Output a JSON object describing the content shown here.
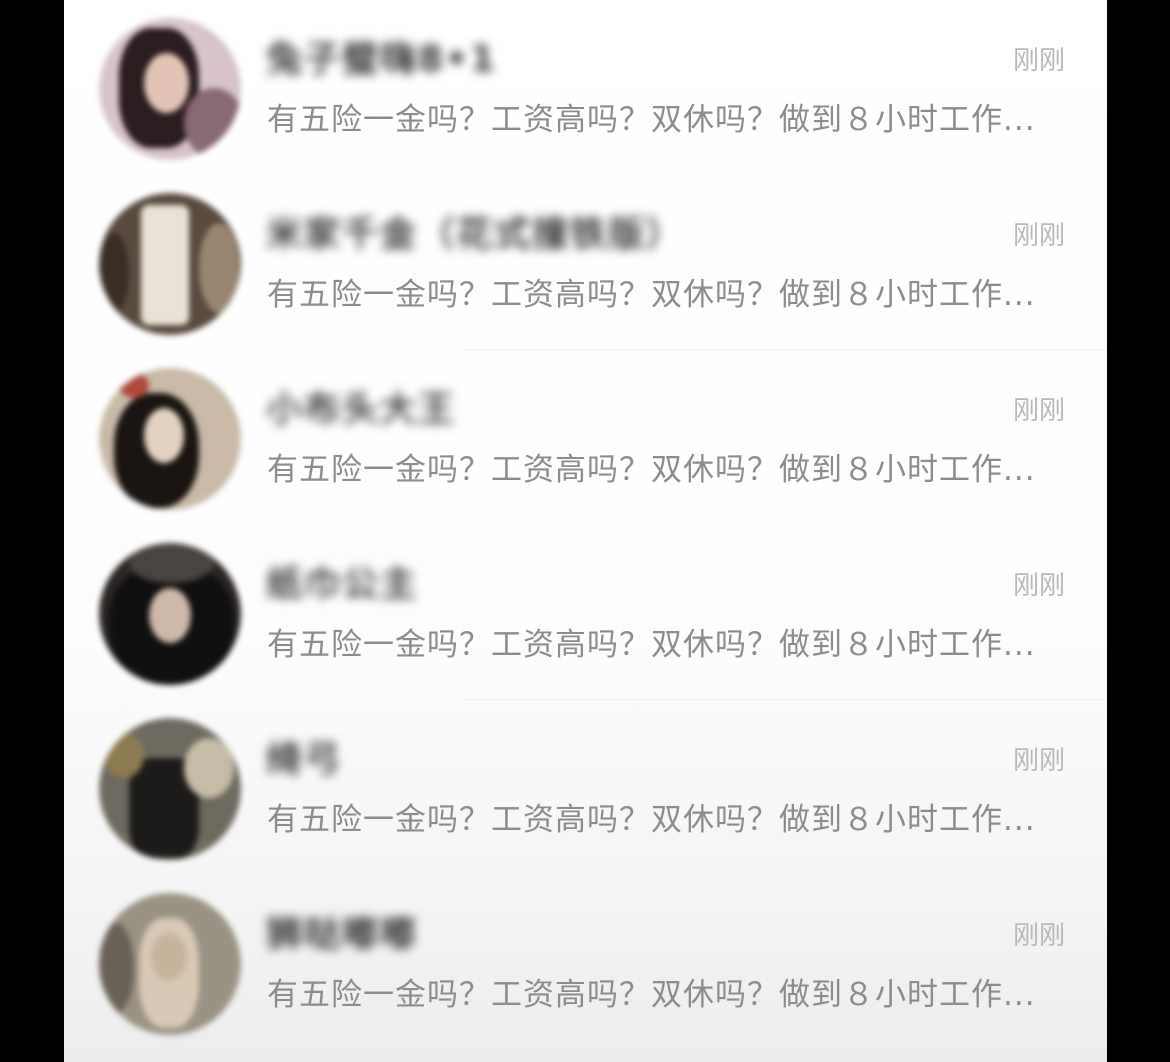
{
  "chats": [
    {
      "name": "兔子璧嗨8•1",
      "time": "刚刚",
      "preview": "有五险一金吗？工资高吗？双休吗？做到８小时工作...",
      "avatar_colors": [
        "#d8c2cc",
        "#2b1c20",
        "#e3c4b4",
        "#8a6a72"
      ]
    },
    {
      "name": "米家千金（花式撞铁版）",
      "time": "刚刚",
      "preview": "有五险一金吗？工资高吗？双休吗？做到８小时工作...",
      "avatar_colors": [
        "#5a4a3e",
        "#e8e2d6",
        "#3a2e26",
        "#9a8670"
      ]
    },
    {
      "name": "小布头大王",
      "time": "刚刚",
      "preview": "有五险一金吗？工资高吗？双休吗？做到８小时工作...",
      "avatar_colors": [
        "#c9b9a6",
        "#1a1512",
        "#e4d2c0",
        "#b04a3a"
      ]
    },
    {
      "name": "纸巾公主",
      "time": "刚刚",
      "preview": "有五险一金吗？工资高吗？双休吗？做到８小时工作...",
      "avatar_colors": [
        "#2a2624",
        "#111010",
        "#cfb8a8",
        "#4a4440"
      ]
    },
    {
      "name": "绮弓",
      "time": "刚刚",
      "preview": "有五险一金吗？工资高吗？双休吗？做到８小时工作...",
      "avatar_colors": [
        "#6e6a60",
        "#1e1c1a",
        "#c6bba4",
        "#8e7a50"
      ]
    },
    {
      "name": "狮哒嘟嘟",
      "time": "刚刚",
      "preview": "有五险一金吗？工资高吗？双休吗？做到８小时工作...",
      "avatar_colors": [
        "#9a9282",
        "#d8c8b4",
        "#6a6256",
        "#c8b49a"
      ]
    }
  ]
}
